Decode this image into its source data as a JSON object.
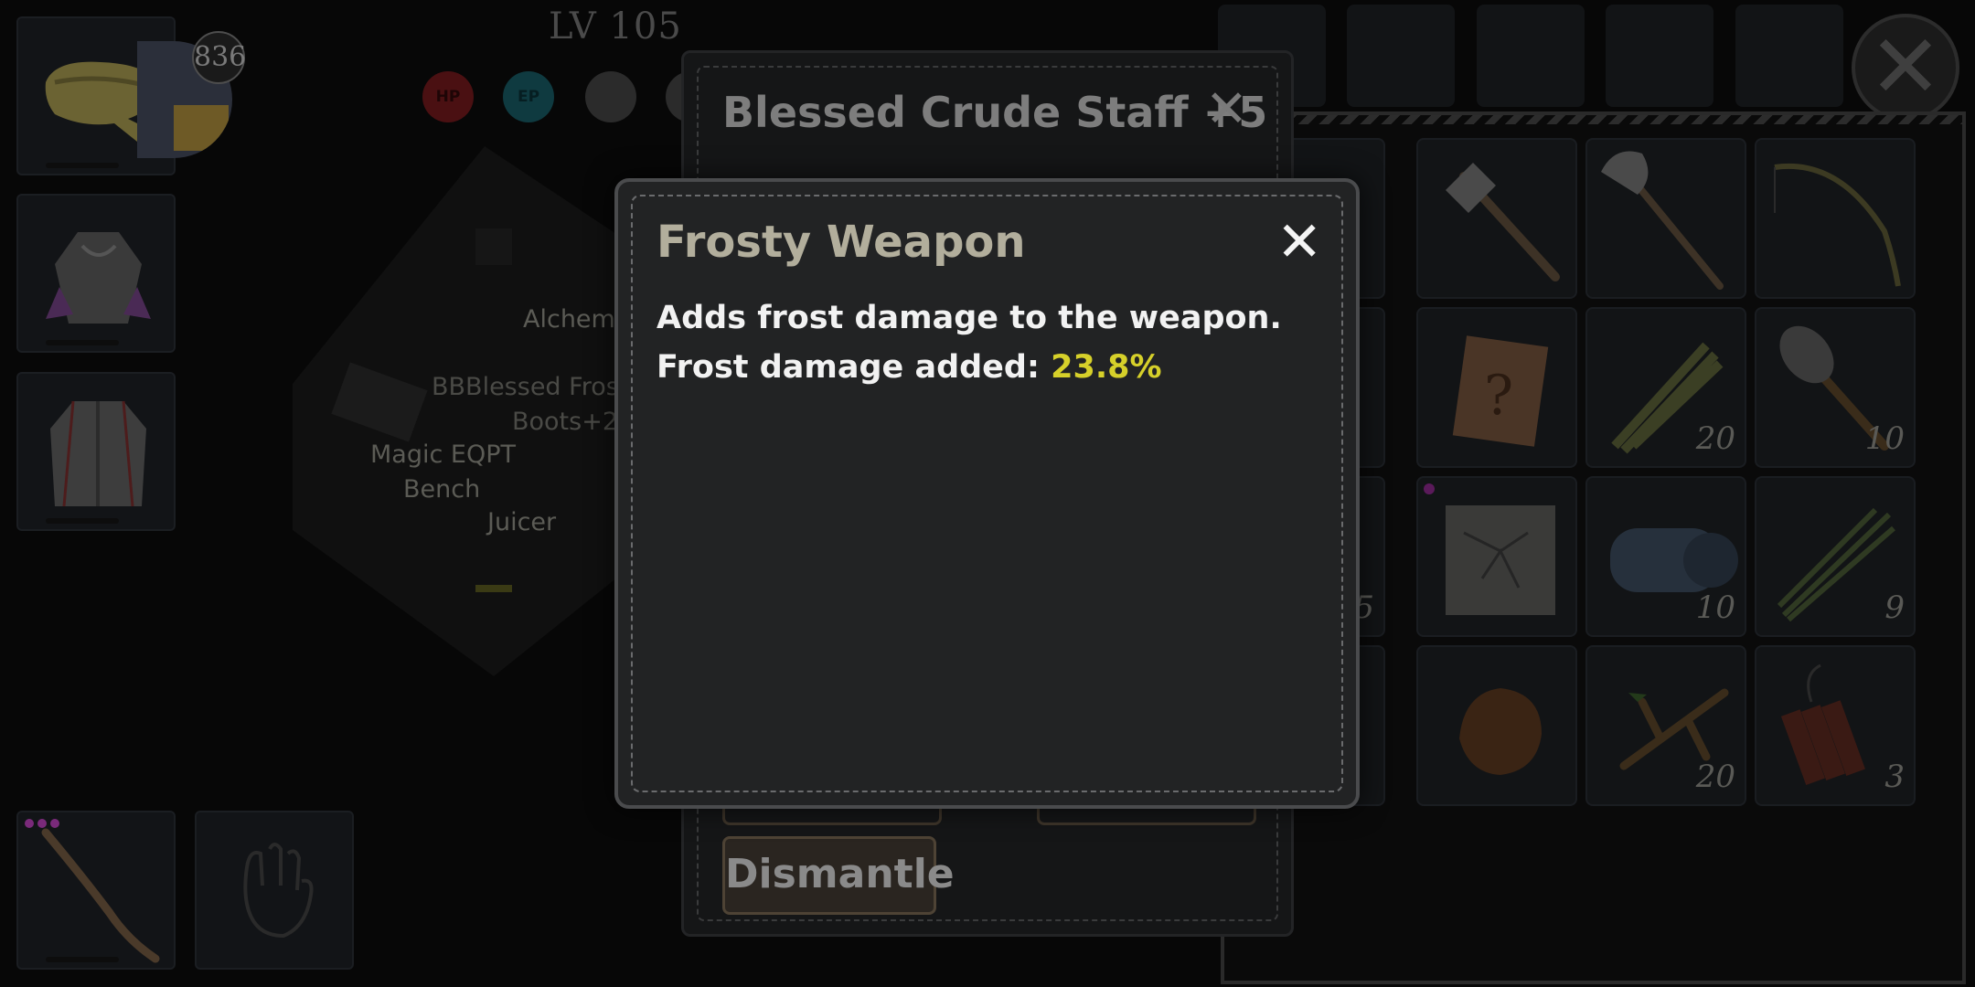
{
  "hud": {
    "level": "LV 105",
    "day_counter": "836",
    "hp_label": "HP",
    "ep_label": "EP"
  },
  "world_labels": {
    "alchemy": "Alchem",
    "blessed_boots_overlay": "BBBlessed Frost",
    "boots_overlay": "Boots+2",
    "magic_eqpt": "Magic EQPT",
    "bench": "Bench",
    "juicer": "Juicer"
  },
  "inventory": {
    "counts": {
      "thatch": "20",
      "torch": "10",
      "stack_5": "5",
      "bedroll": "10",
      "reeds": "9",
      "branch": "20",
      "dynamite": "3"
    }
  },
  "item_panel": {
    "title": "Blessed Crude Staff +5",
    "close_glyph": "✕",
    "dismantle_label": "Dismantle"
  },
  "dialog": {
    "title": "Frosty Weapon",
    "close_glyph": "✕",
    "line1": "Adds frost damage to the weapon.",
    "line2_prefix": "Frost damage added: ",
    "line2_value": "23.8%"
  },
  "main_close_glyph": "✕",
  "colors": {
    "highlight": "#d6d02a",
    "dialog_title": "#b2ae9c",
    "hp": "#c0252a",
    "ep": "#2aa7b8"
  }
}
